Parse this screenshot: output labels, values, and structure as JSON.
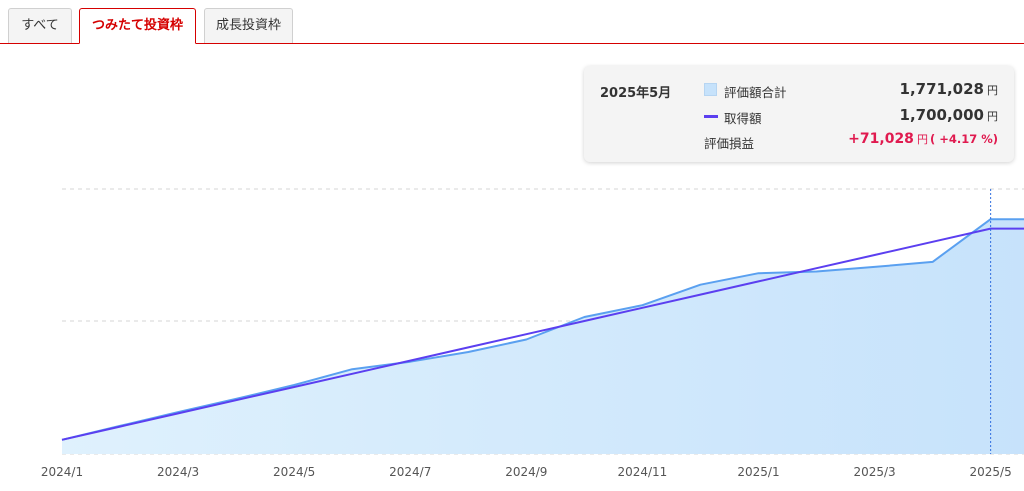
{
  "tabs": [
    {
      "label": "すべて",
      "active": false
    },
    {
      "label": "つみたて投資枠",
      "active": true
    },
    {
      "label": "成長投資枠",
      "active": false
    }
  ],
  "tooltip": {
    "date": "2025年5月",
    "market_value_label": "評価額合計",
    "market_value": "1,771,028",
    "cost_label": "取得額",
    "cost": "1,700,000",
    "pl_label": "評価損益",
    "pl_value": "+71,028",
    "pl_pct": "( +4.17 %)",
    "unit": "円"
  },
  "colors": {
    "accent": "#d50000",
    "market_line": "#5aa0f0",
    "market_fill": "#c6e2fb",
    "cost_line": "#5b3ff0",
    "profit": "#e01a4f"
  },
  "chart_data": {
    "type": "area",
    "x": [
      "2024/1",
      "2024/2",
      "2024/3",
      "2024/4",
      "2024/5",
      "2024/6",
      "2024/7",
      "2024/8",
      "2024/9",
      "2024/10",
      "2024/11",
      "2024/12",
      "2025/1",
      "2025/2",
      "2025/3",
      "2025/4",
      "2025/5",
      "2025/6"
    ],
    "x_tick_labels": [
      "2024/1",
      "2024/3",
      "2024/5",
      "2024/7",
      "2024/9",
      "2024/11",
      "2025/1",
      "2025/3",
      "2025/5"
    ],
    "series": [
      {
        "name": "評価額合計",
        "type": "area",
        "values": [
          100000,
          205000,
          310000,
          410000,
          515000,
          635000,
          692000,
          765000,
          860000,
          1030000,
          1120000,
          1275000,
          1362000,
          1375000,
          1410000,
          1448000,
          1771028,
          1771028
        ]
      },
      {
        "name": "取得額",
        "type": "line",
        "values": [
          100000,
          200000,
          300000,
          400000,
          500000,
          600000,
          700000,
          800000,
          900000,
          1000000,
          1100000,
          1200000,
          1300000,
          1400000,
          1500000,
          1600000,
          1700000,
          1700000
        ]
      }
    ],
    "ylim": [
      0,
      2000000
    ],
    "grid": true,
    "highlight_x": "2025/5"
  }
}
